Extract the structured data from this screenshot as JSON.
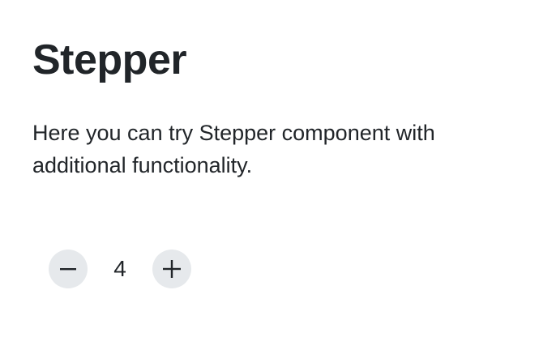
{
  "page": {
    "title": "Stepper",
    "description": "Here you can try Stepper component with additional functionality."
  },
  "stepper": {
    "value": "4",
    "decrement_icon": "minus-icon",
    "increment_icon": "plus-icon"
  },
  "colors": {
    "text": "#212529",
    "button_background": "#e6e9ec",
    "background": "#ffffff"
  }
}
